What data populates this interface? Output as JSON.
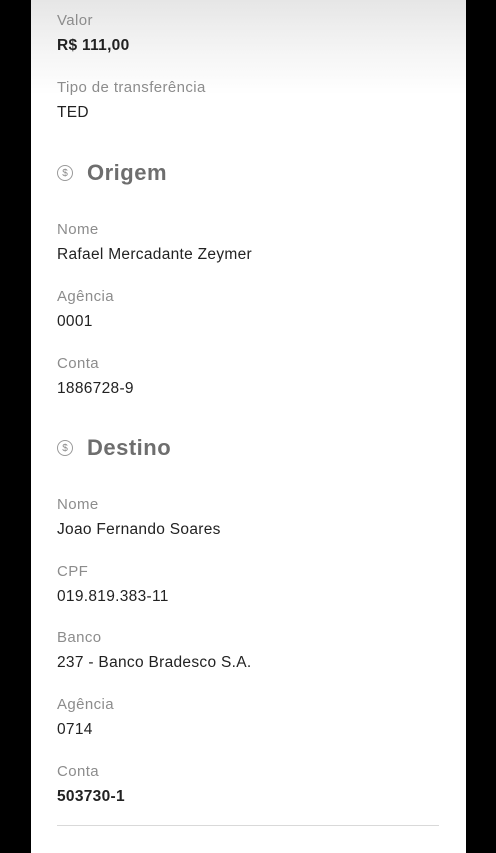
{
  "summary": [
    {
      "label": "Valor",
      "value": "R$ 111,00"
    },
    {
      "label": "Tipo de transferência",
      "value": "TED"
    }
  ],
  "origem": {
    "title": "Origem",
    "icon": "coin-icon",
    "fields": [
      {
        "label": "Nome",
        "value": "Rafael Mercadante Zeymer"
      },
      {
        "label": "Agência",
        "value": "0001"
      },
      {
        "label": "Conta",
        "value": "1886728-9"
      }
    ]
  },
  "destino": {
    "title": "Destino",
    "icon": "coin-icon",
    "fields": [
      {
        "label": "Nome",
        "value": "Joao Fernando Soares"
      },
      {
        "label": "CPF",
        "value": "019.819.383-11"
      },
      {
        "label": "Banco",
        "value": "237 - Banco Bradesco S.A."
      },
      {
        "label": "Agência",
        "value": "0714"
      },
      {
        "label": "Conta",
        "value": "503730-1"
      }
    ]
  },
  "coin_symbol": "$",
  "colors": {
    "background": "#000000",
    "sheet": "#ffffff",
    "label": "#8c8c8c",
    "value": "#222222",
    "section_title": "#6e6e6e"
  }
}
